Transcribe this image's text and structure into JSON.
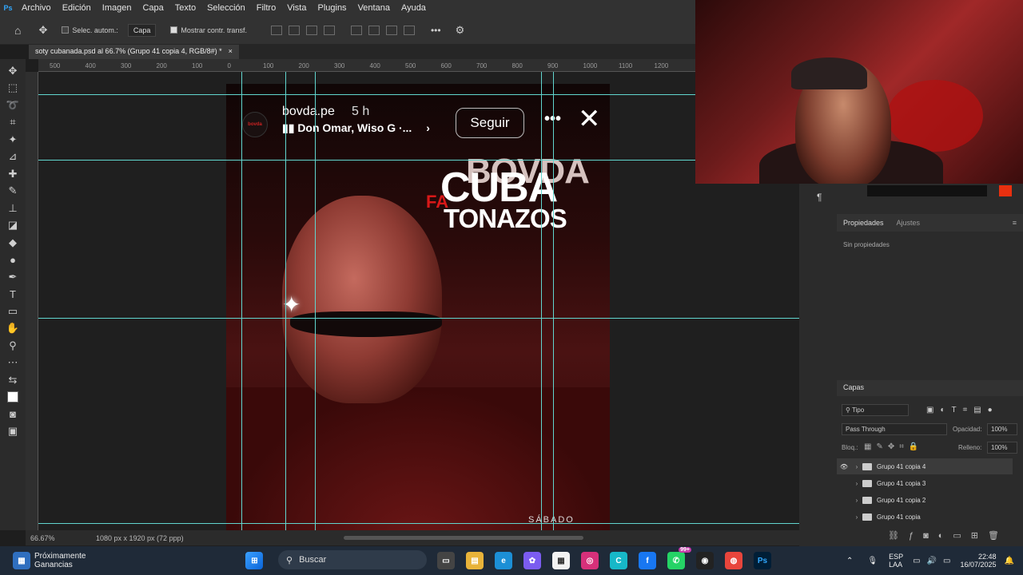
{
  "menubar": {
    "app_icon": "Ps",
    "items": [
      "Archivo",
      "Edición",
      "Imagen",
      "Capa",
      "Texto",
      "Selección",
      "Filtro",
      "Vista",
      "Plugins",
      "Ventana",
      "Ayuda"
    ]
  },
  "options": {
    "autoselect_label": "Selec. autom.:",
    "target_value": "Capa",
    "transform_label": "Mostrar contr. transf.",
    "more": "•••"
  },
  "document": {
    "tab_title": "soty cubanada.psd al 66.7% (Grupo 41 copia 4, RGB/8#) *",
    "close": "×"
  },
  "ruler": {
    "labels": [
      "500",
      "400",
      "300",
      "200",
      "100",
      "0",
      "100",
      "200",
      "300",
      "400",
      "500",
      "600",
      "700",
      "800",
      "900",
      "1000",
      "1100",
      "1200"
    ]
  },
  "story": {
    "avatar_text": "bovda",
    "username": "bovda.pe",
    "time": "5 h",
    "song": "Don Omar, Wiso G ·...",
    "follow": "Seguir",
    "more": "•••",
    "close": "✕"
  },
  "poster": {
    "logo_back": "BOVDA",
    "logo_red": "FA",
    "logo_cuba": "CUBA",
    "logo_tonazos": "TONAZOS",
    "footer": "SÁBADO"
  },
  "status": {
    "zoom": "66.67%",
    "doc_info": "1080 px x 1920 px (72 ppp)"
  },
  "properties": {
    "tab_active": "Propiedades",
    "tab_other": "Ajustes",
    "empty": "Sin propiedades"
  },
  "layers": {
    "title": "Capas",
    "filter_kind": "Tipo",
    "blend_mode": "Pass Through",
    "opacity_label": "Opacidad:",
    "opacity_value": "100%",
    "lock_label": "Bloq.:",
    "fill_label": "Relleno:",
    "fill_value": "100%",
    "rows": [
      {
        "name": "Grupo 41 copia 4",
        "visible": true
      },
      {
        "name": "Grupo 41 copia 3",
        "visible": false
      },
      {
        "name": "Grupo 41 copia 2",
        "visible": false
      },
      {
        "name": "Grupo 41 copia",
        "visible": false
      }
    ]
  },
  "taskbar": {
    "weather_title": "Próximamente",
    "weather_sub": "Ganancias",
    "search_label": "Buscar",
    "whatsapp_badge": "99+",
    "lang": "ESP",
    "lang_sub": "LAA",
    "time": "22:48",
    "date": "16/07/2025"
  },
  "colors": {
    "guide": "#61d6cf",
    "ps_blue": "#31a8ff",
    "accent_red": "#d81818"
  }
}
